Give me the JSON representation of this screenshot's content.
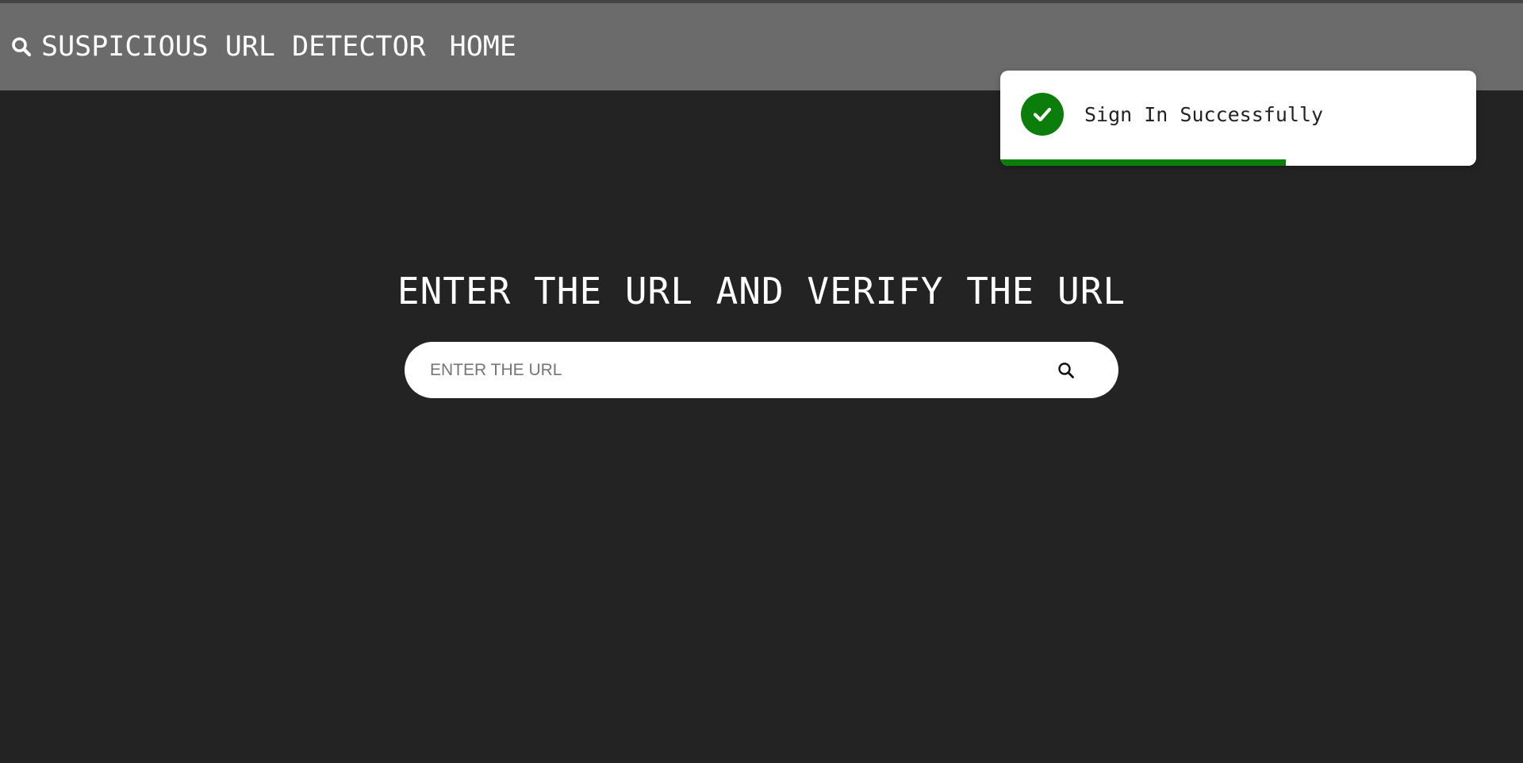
{
  "navbar": {
    "brand_icon": "search-icon",
    "brand_label": "SUSPICIOUS URL DETECTOR",
    "home_label": "HOME"
  },
  "main": {
    "title": "ENTER THE URL AND VERIFY THE URL",
    "search": {
      "placeholder": "ENTER THE URL",
      "value": "",
      "button_icon": "search-icon"
    }
  },
  "toast": {
    "icon": "check-circle-icon",
    "message": "Sign In Successfully",
    "progress": 0.6,
    "accent_color": "#0a7d0a"
  },
  "colors": {
    "page_background": "#232323",
    "navbar_background": "#6b6b6b",
    "text": "#ffffff"
  }
}
